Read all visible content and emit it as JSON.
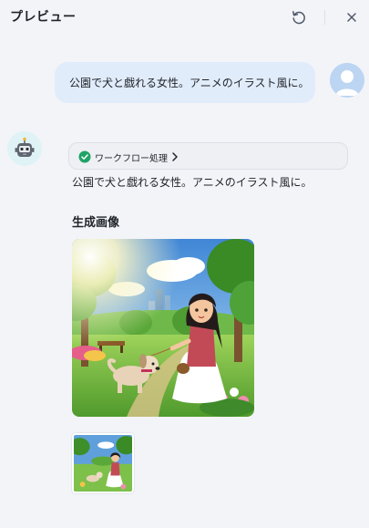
{
  "header": {
    "title": "プレビュー",
    "restart_icon": "restart-icon",
    "close_icon": "close-icon"
  },
  "user_message": {
    "text": "公園で犬と戯れる女性。アニメのイラスト風に。",
    "avatar_icon": "user-avatar-icon"
  },
  "bot_message": {
    "avatar_icon": "robot-avatar-icon",
    "workflow": {
      "label": "ワークフロー処理",
      "status_icon": "check-circle-icon",
      "expand_icon": "chevron-right-icon",
      "status_color": "#21a366"
    },
    "text": "公園で犬と戯れる女性。アニメのイラスト風に。",
    "images_section_title": "生成画像"
  },
  "colors": {
    "background": "#f3f4f8",
    "user_bubble": "#e1ecfb",
    "workflow_chip": "#eef0f4"
  }
}
